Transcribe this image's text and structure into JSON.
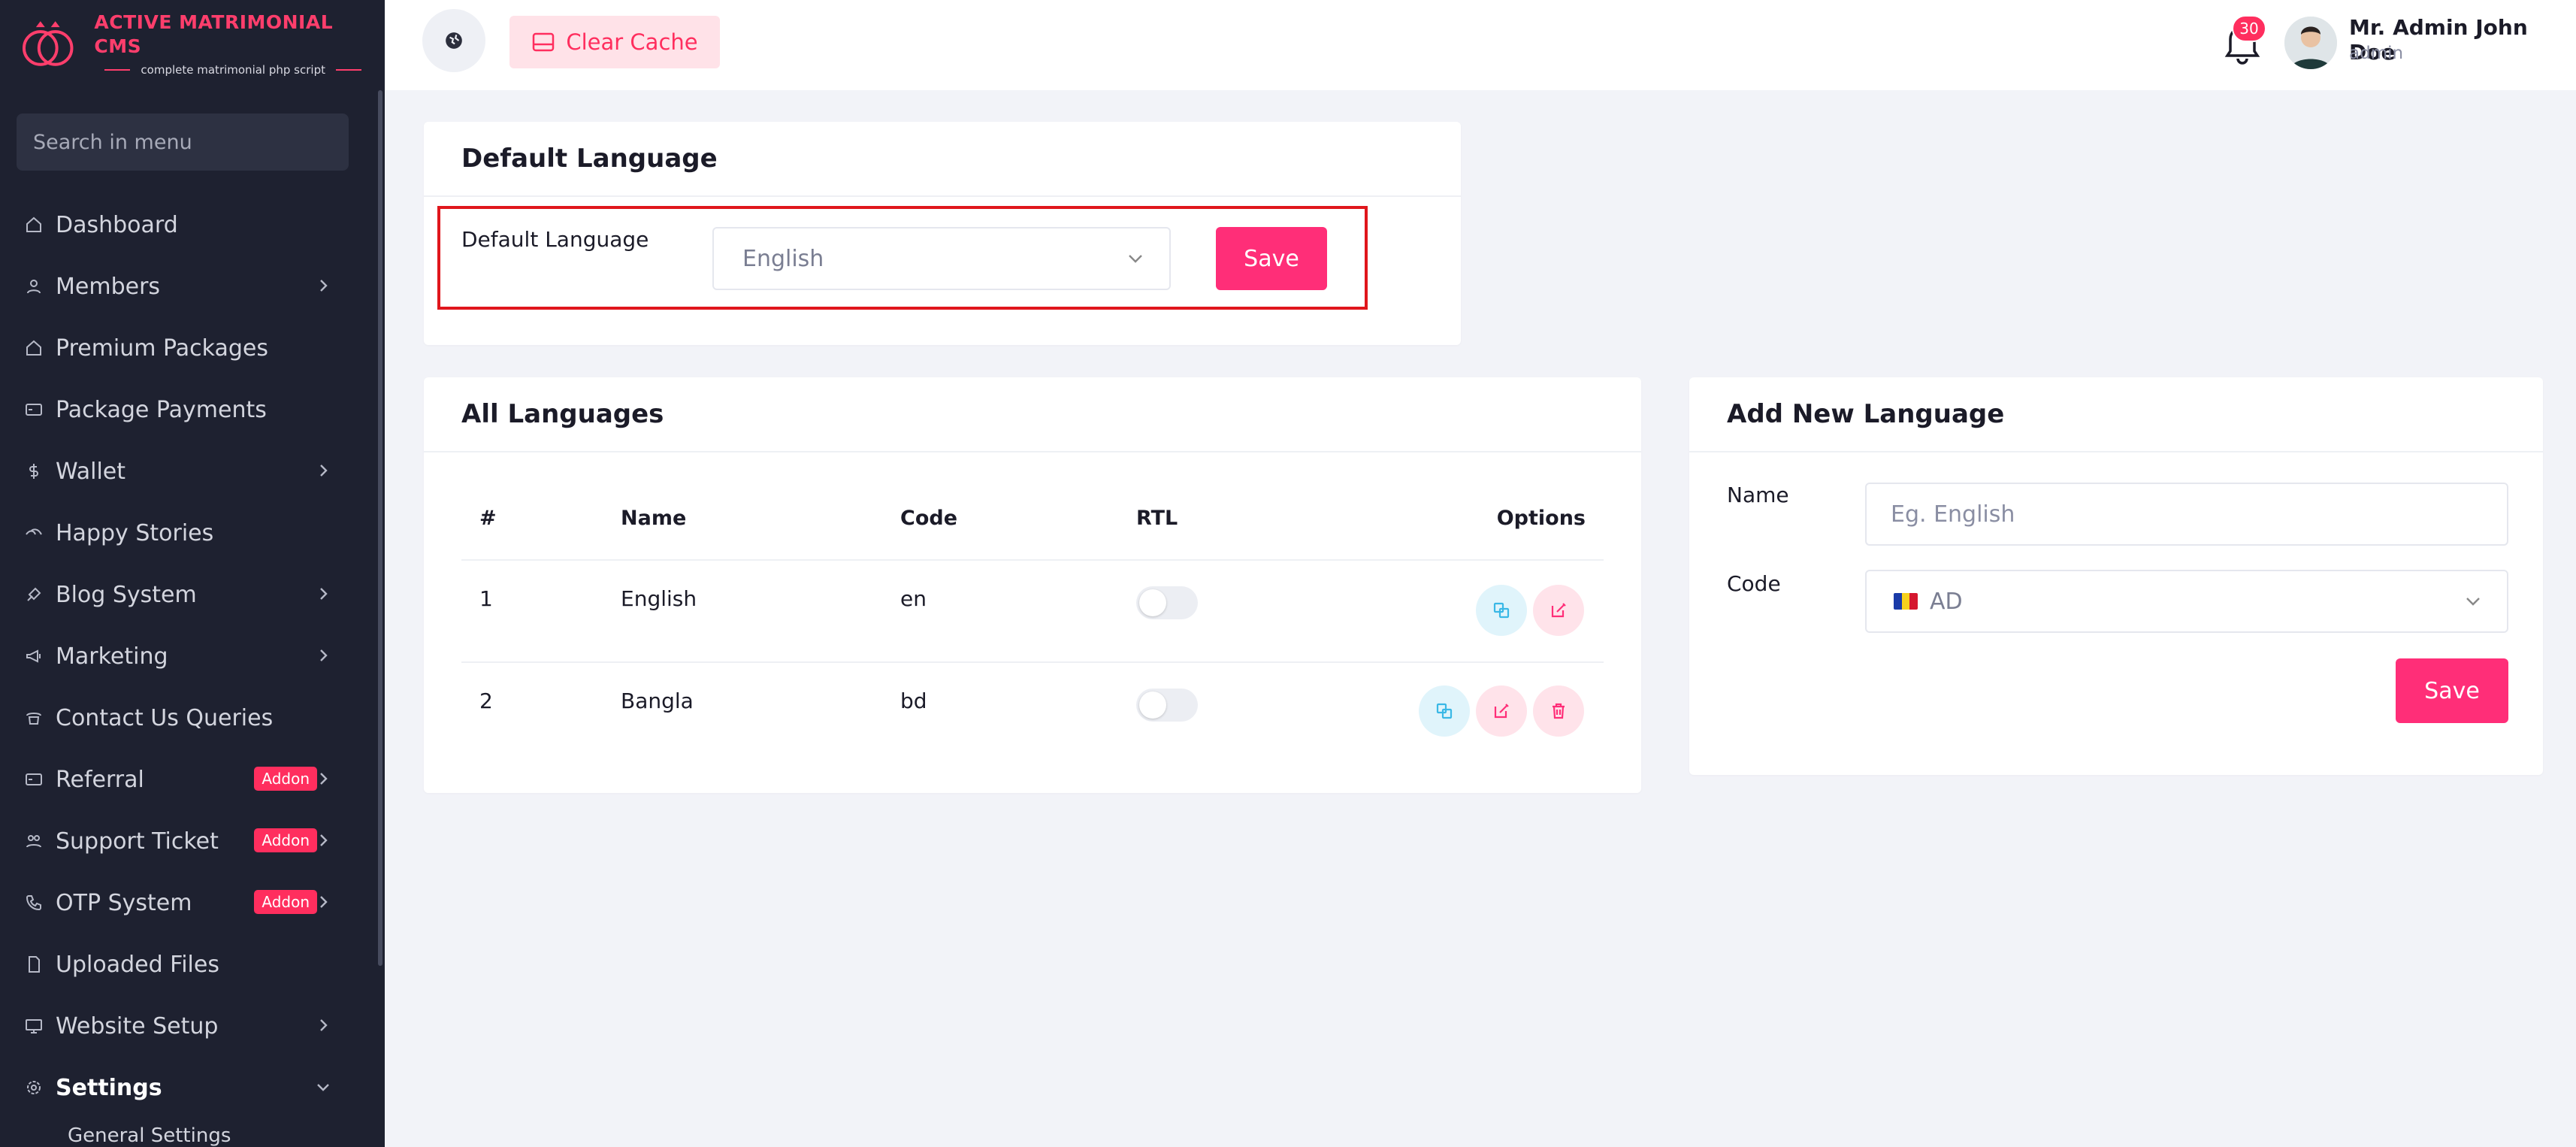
{
  "brand": {
    "title": "ACTIVE MATRIMONIAL CMS",
    "subtitle": "complete matrimonial php script",
    "accent": "#ff3e6c"
  },
  "sidebar": {
    "search_placeholder": "Search in menu",
    "items": [
      {
        "label": "Dashboard",
        "icon": "home-icon",
        "has_chevron": false
      },
      {
        "label": "Members",
        "icon": "user-icon",
        "has_chevron": true
      },
      {
        "label": "Premium Packages",
        "icon": "home-icon",
        "has_chevron": false
      },
      {
        "label": "Package Payments",
        "icon": "card-icon",
        "has_chevron": false
      },
      {
        "label": "Wallet",
        "icon": "dollar-icon",
        "has_chevron": true
      },
      {
        "label": "Happy Stories",
        "icon": "heart-hands-icon",
        "has_chevron": false
      },
      {
        "label": "Blog System",
        "icon": "blog-icon",
        "has_chevron": true
      },
      {
        "label": "Marketing",
        "icon": "megaphone-icon",
        "has_chevron": true
      },
      {
        "label": "Contact Us Queries",
        "icon": "phone-icon",
        "has_chevron": false
      },
      {
        "label": "Referral",
        "icon": "card-icon",
        "has_chevron": true,
        "badge": "Addon"
      },
      {
        "label": "Support Ticket",
        "icon": "support-icon",
        "has_chevron": true,
        "badge": "Addon"
      },
      {
        "label": "OTP System",
        "icon": "phone-call-icon",
        "has_chevron": true,
        "badge": "Addon"
      },
      {
        "label": "Uploaded Files",
        "icon": "file-icon",
        "has_chevron": false
      },
      {
        "label": "Website Setup",
        "icon": "monitor-icon",
        "has_chevron": true
      },
      {
        "label": "Settings",
        "icon": "gear-icon",
        "has_chevron": true,
        "expanded": true
      }
    ],
    "sub_item": "General Settings"
  },
  "topbar": {
    "clear_cache_label": "Clear Cache",
    "notification_count": "30",
    "user_name": "Mr. Admin John Doe",
    "user_role": "admin"
  },
  "default_language": {
    "card_title": "Default Language",
    "field_label": "Default Language",
    "selected": "English",
    "save_label": "Save"
  },
  "all_languages": {
    "card_title": "All Languages",
    "columns": [
      "#",
      "Name",
      "Code",
      "RTL",
      "Options"
    ],
    "rows": [
      {
        "num": "1",
        "name": "English",
        "code": "en",
        "rtl": false,
        "options": [
          "translate-icon",
          "edit-icon"
        ]
      },
      {
        "num": "2",
        "name": "Bangla",
        "code": "bd",
        "rtl": false,
        "options": [
          "translate-icon",
          "edit-icon",
          "trash-icon"
        ]
      }
    ]
  },
  "add_language": {
    "card_title": "Add New Language",
    "name_label": "Name",
    "name_placeholder": "Eg. English",
    "code_label": "Code",
    "code_selected": "AD",
    "save_label": "Save"
  },
  "colors": {
    "sidebar_bg": "#1e2130",
    "primary": "#ff2e78",
    "highlight_border": "#e0161c"
  }
}
